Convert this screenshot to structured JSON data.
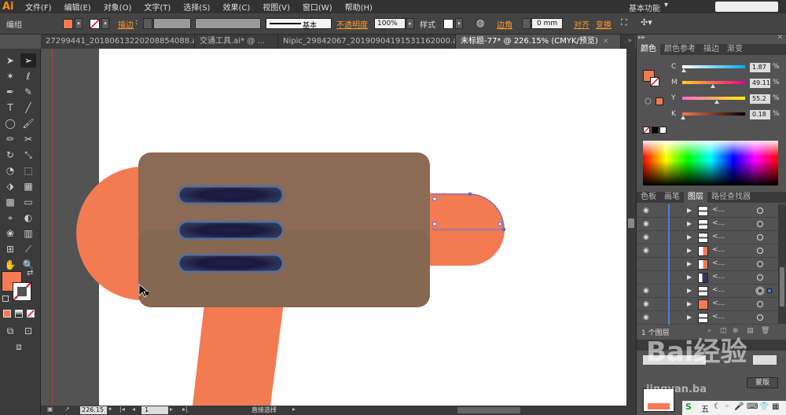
{
  "app": {
    "logo": "Ai"
  },
  "menu": [
    "文件(F)",
    "编辑(E)",
    "对象(O)",
    "文字(T)",
    "选择(S)",
    "效果(C)",
    "视图(V)",
    "窗口(W)",
    "帮助(H)"
  ],
  "workspace": "基本功能",
  "control_bar": {
    "group_label": "编组",
    "stroke_label": "描边",
    "stroke_style": "基本",
    "opacity_label": "不透明度",
    "opacity_value": "100%",
    "style_label": "样式",
    "corner_label": "边角",
    "corner_value": "0 mm",
    "align_label": "对齐",
    "transform_label": "变换",
    "fill_color": "#f47a52"
  },
  "tabs": [
    {
      "label": "27299441_20180613220208854088.ai*",
      "active": false
    },
    {
      "label": "交通工具.ai* @ ...",
      "active": false
    },
    {
      "label": "Nipic_29842067_20190904191531162000.ai*",
      "active": false
    },
    {
      "label": "未标题-77* @ 226.15% (CMYK/预览)",
      "active": true
    }
  ],
  "status": {
    "zoom": "226.15",
    "page": "1",
    "tool": "直接选择"
  },
  "color_panel": {
    "tabs": [
      "颜色",
      "颜色参考",
      "描边",
      "渐变"
    ],
    "channels": [
      {
        "label": "C",
        "value": "1.87",
        "position": 0.02,
        "gradient": "linear-gradient(to right,#fff,#00aeef)"
      },
      {
        "label": "M",
        "value": "49.11",
        "position": 0.49,
        "gradient": "linear-gradient(to right,#ffd21a,#ec008c)"
      },
      {
        "label": "Y",
        "value": "55.2",
        "position": 0.55,
        "gradient": "linear-gradient(to right,#ff6ad1,#fff200)"
      },
      {
        "label": "K",
        "value": "0.18",
        "position": 0.01,
        "gradient": "linear-gradient(to right,#f47a52,#000)"
      }
    ],
    "pct": "%"
  },
  "layers_panel": {
    "tabs": [
      "色板",
      "画笔",
      "图层",
      "路径查找器"
    ],
    "rows": [
      {
        "name": "<...",
        "visible": true,
        "thumb": "line"
      },
      {
        "name": "<...",
        "visible": true,
        "thumb": "line"
      },
      {
        "name": "<...",
        "visible": true,
        "thumb": "line"
      },
      {
        "name": "<...",
        "visible": true,
        "thumb": "half"
      },
      {
        "name": "<...",
        "visible": false,
        "thumb": "half"
      },
      {
        "name": "<...",
        "visible": false,
        "thumb": "dark"
      },
      {
        "name": "<...",
        "visible": true,
        "thumb": "line",
        "selected": true
      },
      {
        "name": "<...",
        "visible": true,
        "thumb": "orange"
      },
      {
        "name": "<...",
        "visible": true,
        "thumb": "line"
      }
    ],
    "footer": "1 个图层"
  },
  "bottom_panel": {
    "label": "蒙版"
  },
  "watermark": {
    "text": "经验",
    "sub": "Bai",
    "url": "jingyan.ba"
  }
}
